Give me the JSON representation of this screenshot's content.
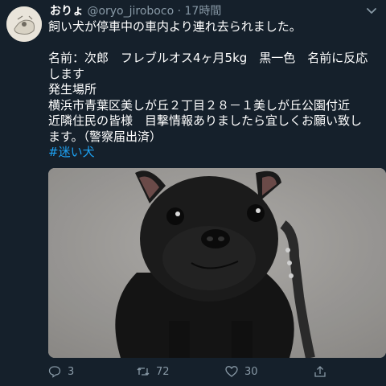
{
  "tweet": {
    "display_name": "おりょ",
    "handle": "@oryo_jiroboco",
    "separator": "·",
    "time": "17時間",
    "lines": [
      "飼い犬が停車中の車内より連れ去られました。",
      "",
      "名前：次郎　フレブルオス4ヶ月5kg　黒一色　名前に反応",
      "します",
      "発生場所",
      "横浜市青葉区美しが丘２丁目２８－１美しが丘公園付近",
      "近隣住民の皆様　目撃情報ありましたら宜しくお願い致し",
      "ます。（警察届出済）"
    ],
    "hashtag": "#迷い犬"
  },
  "actions": {
    "reply_count": "3",
    "retweet_count": "72",
    "like_count": "30"
  },
  "colors": {
    "background": "#15202b",
    "text": "#ffffff",
    "secondary": "#8899a6",
    "link": "#1da1f2"
  },
  "icons": {
    "reply": "reply-icon",
    "retweet": "retweet-icon",
    "like": "heart-icon",
    "share": "share-icon",
    "menu": "chevron-down-icon"
  }
}
